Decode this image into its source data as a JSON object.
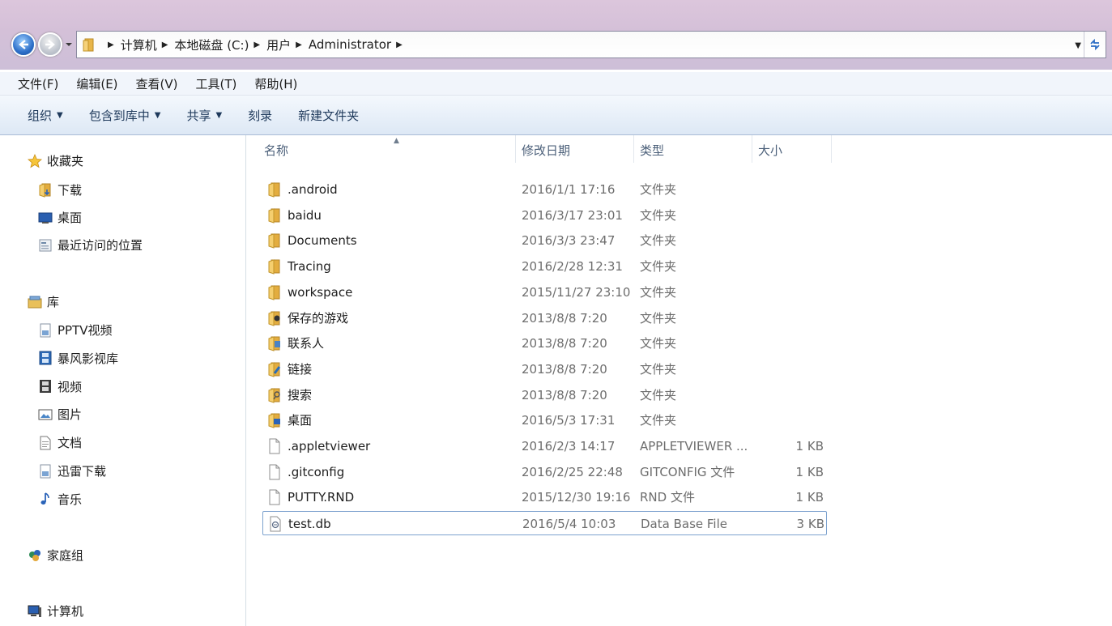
{
  "address": {
    "crumbs": [
      "计算机",
      "本地磁盘 (C:)",
      "用户",
      "Administrator"
    ]
  },
  "menu": [
    "文件(F)",
    "编辑(E)",
    "查看(V)",
    "工具(T)",
    "帮助(H)"
  ],
  "commands": [
    {
      "label": "组织",
      "dropdown": true
    },
    {
      "label": "包含到库中",
      "dropdown": true
    },
    {
      "label": "共享",
      "dropdown": true
    },
    {
      "label": "刻录",
      "dropdown": false
    },
    {
      "label": "新建文件夹",
      "dropdown": false
    }
  ],
  "nav": {
    "favorites": {
      "label": "收藏夹",
      "icon": "star-icon"
    },
    "favorite_items": [
      {
        "label": "下载",
        "icon": "download-folder-icon"
      },
      {
        "label": "桌面",
        "icon": "desktop-icon"
      },
      {
        "label": "最近访问的位置",
        "icon": "recent-places-icon"
      }
    ],
    "libraries": {
      "label": "库",
      "icon": "library-icon"
    },
    "library_items": [
      {
        "label": "PPTV视频",
        "icon": "library-item-icon"
      },
      {
        "label": "暴风影视库",
        "icon": "video-library-icon"
      },
      {
        "label": "视频",
        "icon": "video-icon"
      },
      {
        "label": "图片",
        "icon": "pictures-icon"
      },
      {
        "label": "文档",
        "icon": "documents-icon"
      },
      {
        "label": "迅雷下载",
        "icon": "library-item-icon"
      },
      {
        "label": "音乐",
        "icon": "music-icon"
      }
    ],
    "homegroup": {
      "label": "家庭组",
      "icon": "homegroup-icon"
    },
    "computer": {
      "label": "计算机",
      "icon": "computer-icon"
    }
  },
  "columns": {
    "name": "名称",
    "date": "修改日期",
    "type": "类型",
    "size": "大小"
  },
  "files": [
    {
      "name": ".android",
      "date": "2016/1/1 17:16",
      "type": "文件夹",
      "size": "",
      "icon": "folder-icon"
    },
    {
      "name": "baidu",
      "date": "2016/3/17 23:01",
      "type": "文件夹",
      "size": "",
      "icon": "folder-icon"
    },
    {
      "name": "Documents",
      "date": "2016/3/3 23:47",
      "type": "文件夹",
      "size": "",
      "icon": "folder-icon"
    },
    {
      "name": "Tracing",
      "date": "2016/2/28 12:31",
      "type": "文件夹",
      "size": "",
      "icon": "folder-icon"
    },
    {
      "name": "workspace",
      "date": "2015/11/27 23:10",
      "type": "文件夹",
      "size": "",
      "icon": "folder-icon"
    },
    {
      "name": "保存的游戏",
      "date": "2013/8/8 7:20",
      "type": "文件夹",
      "size": "",
      "icon": "saved-games-folder-icon"
    },
    {
      "name": "联系人",
      "date": "2013/8/8 7:20",
      "type": "文件夹",
      "size": "",
      "icon": "contacts-folder-icon"
    },
    {
      "name": "链接",
      "date": "2013/8/8 7:20",
      "type": "文件夹",
      "size": "",
      "icon": "links-folder-icon"
    },
    {
      "name": "搜索",
      "date": "2013/8/8 7:20",
      "type": "文件夹",
      "size": "",
      "icon": "searches-folder-icon"
    },
    {
      "name": "桌面",
      "date": "2016/5/3 17:31",
      "type": "文件夹",
      "size": "",
      "icon": "desktop-folder-icon"
    },
    {
      "name": ".appletviewer",
      "date": "2016/2/3 14:17",
      "type": "APPLETVIEWER ...",
      "size": "1 KB",
      "icon": "file-icon"
    },
    {
      "name": ".gitconfig",
      "date": "2016/2/25 22:48",
      "type": "GITCONFIG 文件",
      "size": "1 KB",
      "icon": "file-icon"
    },
    {
      "name": "PUTTY.RND",
      "date": "2015/12/30 19:16",
      "type": "RND 文件",
      "size": "1 KB",
      "icon": "file-icon"
    },
    {
      "name": "test.db",
      "date": "2016/5/4 10:03",
      "type": "Data Base File",
      "size": "3 KB",
      "icon": "db-file-icon",
      "selected": true
    }
  ]
}
